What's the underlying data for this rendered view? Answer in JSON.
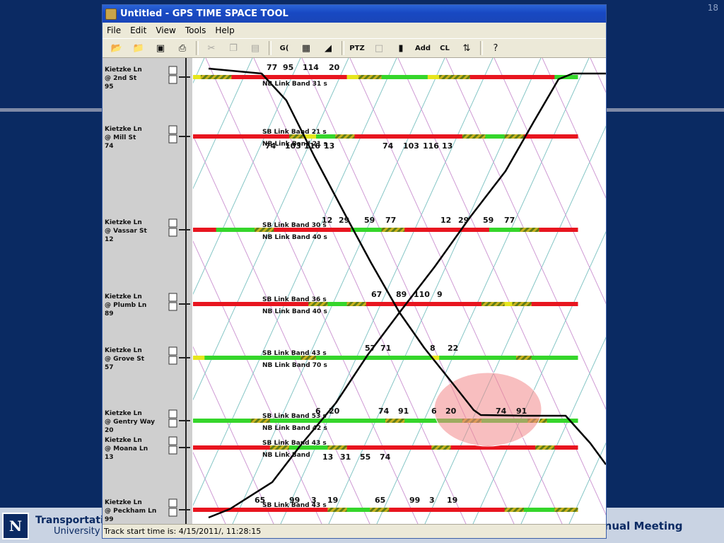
{
  "slide": {
    "number": "18",
    "footer_line1": "Transportati",
    "footer_line2": "University",
    "footer_right": "nnual Meeting",
    "logo_glyph": "N"
  },
  "window": {
    "title": "Untitled - GPS TIME SPACE TOOL",
    "menu": [
      "File",
      "Edit",
      "View",
      "Tools",
      "Help"
    ],
    "toolbar": {
      "open_icon": "open-folder-icon",
      "save_icon": "save-disk-icon",
      "print_icon": "print-icon",
      "cut_icon": "cut-icon",
      "copy_icon": "copy-icon",
      "paste_icon": "paste-icon",
      "g_label": "G(",
      "ptz_label": "PTZ",
      "add_label": "Add",
      "cl_label": "CL",
      "help_glyph": "?"
    },
    "status": "Track start time is: 4/15/2011/, 11:28:15"
  },
  "colors": {
    "red": "#e8151f",
    "green": "#35d62b",
    "yellow": "#e6e61e",
    "hatch": "#6f8a1a",
    "nb_line": "#85c6c6",
    "sb_line": "#cf9ad4",
    "track": "#000000",
    "highlight": "#f2888a"
  },
  "intersections": [
    {
      "name": "Kietzke Ln",
      "cross": "@ 2nd St",
      "id": "95",
      "top": [
        "77",
        "95",
        "114",
        "20"
      ],
      "bottom": [],
      "band_labels": [
        "NB Link Band 31 s"
      ]
    },
    {
      "name": "Kietzke Ln",
      "cross": "@ Mill St",
      "id": "74",
      "top": [],
      "bottom": [
        "74",
        "103",
        "116",
        "13",
        "74",
        "103",
        "116",
        "13"
      ],
      "band_labels": [
        "SB Link Band 21 s",
        "NB Link Band 21 s"
      ]
    },
    {
      "name": "Kietzke Ln",
      "cross": "@ Vassar St",
      "id": "12",
      "top": [
        "12",
        "29",
        "59",
        "77",
        "12",
        "29",
        "59",
        "77"
      ],
      "bottom": [],
      "band_labels": [
        "SB Link Band 30 s",
        "NB Link Band 40 s"
      ]
    },
    {
      "name": "Kietzke Ln",
      "cross": "@ Plumb Ln",
      "id": "89",
      "top": [
        "67",
        "89",
        "110",
        "9"
      ],
      "bottom": [],
      "band_labels": [
        "SB Link Band 36 s",
        "NB Link Band 40 s"
      ]
    },
    {
      "name": "Kietzke Ln",
      "cross": "@ Grove St",
      "id": "57",
      "top": [
        "57",
        "71",
        "8",
        "22"
      ],
      "bottom": [],
      "band_labels": [
        "SB Link Band 43 s",
        "NB Link Band 70 s"
      ]
    },
    {
      "name": "Kietzke Ln",
      "cross": "@ Gentry Way",
      "id": "20",
      "top": [
        "6",
        "20",
        "74",
        "91",
        "6",
        "20",
        "74",
        "91"
      ],
      "bottom": [],
      "band_labels": [
        "SB Link Band 53 s",
        "NB Link Band 42 s"
      ]
    },
    {
      "name": "Kietzke Ln",
      "cross": "@ Moana Ln",
      "id": "13",
      "top": [],
      "bottom": [
        "13",
        "31",
        "55",
        "74"
      ],
      "band_labels": [
        "SB Link Band 43 s",
        "NB Link Band"
      ]
    },
    {
      "name": "Kietzke Ln",
      "cross": "@ Peckham Ln",
      "id": "99",
      "top": [
        "65",
        "99",
        "3",
        "19",
        "65",
        "99",
        "3",
        "19"
      ],
      "bottom": [],
      "band_labels": [
        "SB Link Band 43 s"
      ]
    }
  ]
}
